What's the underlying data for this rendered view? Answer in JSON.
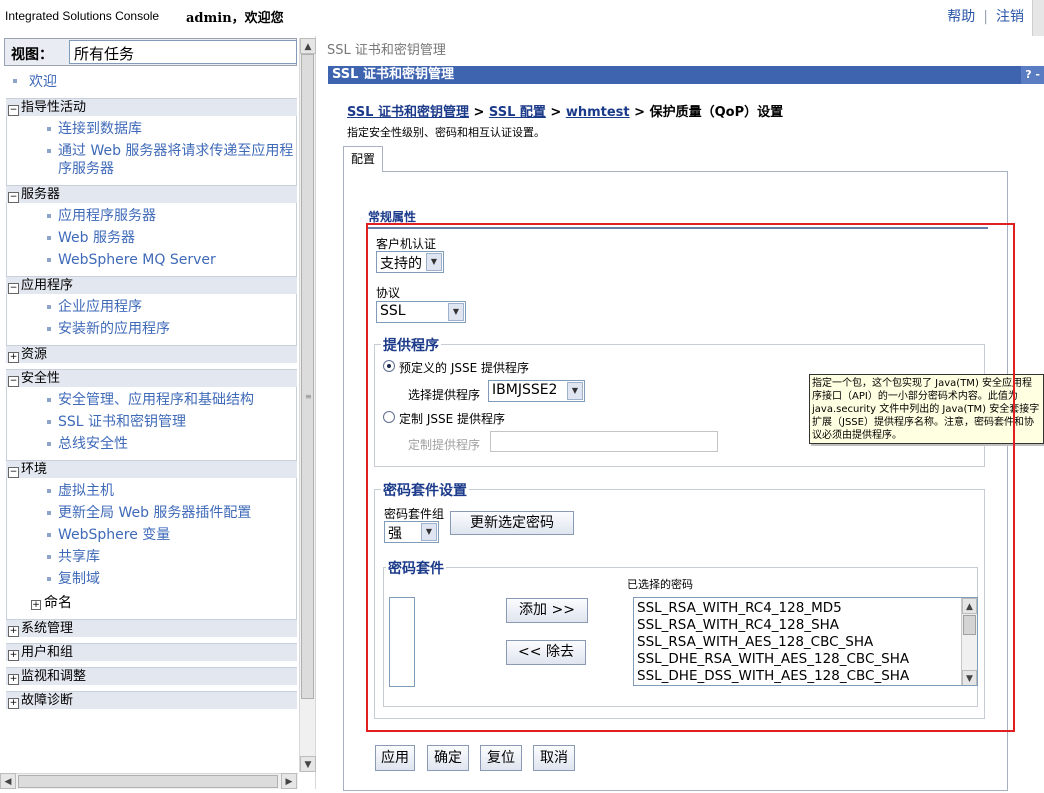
{
  "header": {
    "brand": "Integrated Solutions Console",
    "welcome": "admin，欢迎您",
    "help": "帮助",
    "logout": "注销",
    "separator": "|"
  },
  "sidebar": {
    "view_label": "视图：",
    "view_value": "所有任务",
    "welcome": "欢迎",
    "groups": [
      {
        "title": "指导性活动",
        "expanded": true,
        "items": [
          "连接到数据库",
          "通过 Web 服务器将请求传递至应用程序服务器"
        ]
      },
      {
        "title": "服务器",
        "expanded": true,
        "items": [
          "应用程序服务器",
          "Web 服务器",
          "WebSphere MQ Server"
        ]
      },
      {
        "title": "应用程序",
        "expanded": true,
        "items": [
          "企业应用程序",
          "安装新的应用程序"
        ]
      },
      {
        "title": "资源",
        "expanded": false,
        "items": []
      },
      {
        "title": "安全性",
        "expanded": true,
        "items": [
          "安全管理、应用程序和基础结构",
          "SSL 证书和密钥管理",
          "总线安全性"
        ]
      },
      {
        "title": "环境",
        "expanded": true,
        "items": [
          "虚拟主机",
          "更新全局 Web 服务器插件配置",
          "WebSphere 变量",
          "共享库",
          "复制域"
        ],
        "sub": "命名"
      },
      {
        "title": "系统管理",
        "expanded": false,
        "items": []
      },
      {
        "title": "用户和组",
        "expanded": false,
        "items": []
      },
      {
        "title": "监视和调整",
        "expanded": false,
        "items": []
      },
      {
        "title": "故障诊断",
        "expanded": false,
        "items": []
      }
    ],
    "toggle_expanded": "⊟",
    "toggle_collapsed": "⊞"
  },
  "main": {
    "page_crumb": "SSL 证书和密钥管理",
    "panel_title": "SSL 证书和密钥管理",
    "panel_buttons": "? -",
    "breadcrumb": {
      "link1": "SSL 证书和密钥管理",
      "link2": "SSL 配置",
      "link3": "whmtest",
      "current": "保护质量（QoP）设置",
      "sep": ">"
    },
    "description": "指定安全性级别、密码和相互认证设置。",
    "tab": "配置",
    "general_heading": "常规属性",
    "client_auth_label": "客户机认证",
    "client_auth_value": "支持的",
    "protocol_label": "协议",
    "protocol_value": "SSL",
    "provider": {
      "legend": "提供程序",
      "predefined_label": "预定义的 JSSE 提供程序",
      "select_label": "选择提供程序",
      "select_value": "IBMJSSE2",
      "custom_label": "定制 JSSE 提供程序",
      "custom_field_label": "定制提供程序",
      "custom_field_value": ""
    },
    "cipher_settings": {
      "legend": "密码套件设置",
      "group_label": "密码套件组",
      "group_value": "强",
      "update_button": "更新选定密码"
    },
    "cipher_suites": {
      "legend": "密码套件",
      "selected_label": "已选择的密码",
      "add_button": "添加 >>",
      "remove_button": "<< 除去",
      "available": [],
      "selected": [
        "SSL_RSA_WITH_RC4_128_MD5",
        "SSL_RSA_WITH_RC4_128_SHA",
        "SSL_RSA_WITH_AES_128_CBC_SHA",
        "SSL_DHE_RSA_WITH_AES_128_CBC_SHA",
        "SSL_DHE_DSS_WITH_AES_128_CBC_SHA"
      ]
    },
    "buttons": {
      "apply": "应用",
      "ok": "确定",
      "reset": "复位",
      "cancel": "取消"
    },
    "tooltip": "指定一个包，这个包实现了 Java(TM) 安全应用程序接口（API）的一小部分密码术内容。此值为 java.security 文件中列出的 Java(TM) 安全套接字扩展（JSSE）提供程序名称。注意，密码套件和协议必须由提供程序。"
  },
  "colors": {
    "titlebar": "#3e64b0",
    "link": "#3f6ab8",
    "highlight": "#e02020",
    "tooltip_bg": "#ffffe1"
  }
}
